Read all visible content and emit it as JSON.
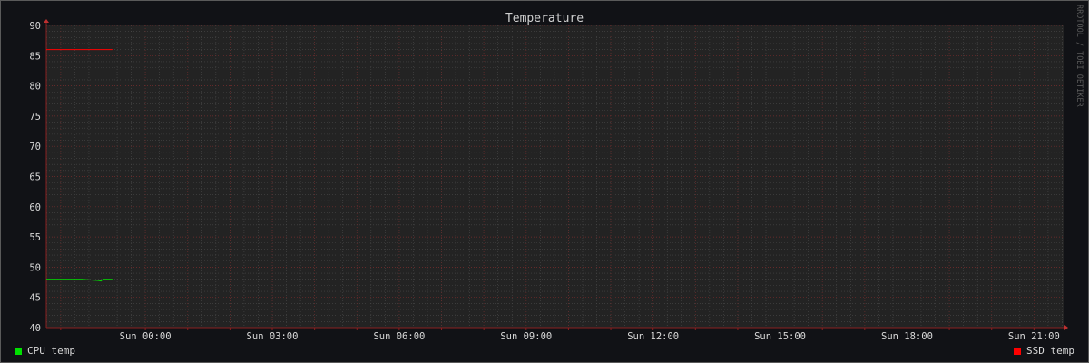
{
  "chart_data": {
    "type": "line",
    "title": "Temperature",
    "watermark": "RRDTOOL / TOBI OETIKER",
    "y_range": [
      40,
      90
    ],
    "y_ticks": [
      40,
      45,
      50,
      55,
      60,
      65,
      70,
      75,
      80,
      85,
      90
    ],
    "x_tick_labels": [
      "Sun 00:00",
      "Sun 03:00",
      "Sun 06:00",
      "Sun 09:00",
      "Sun 12:00",
      "Sun 15:00",
      "Sun 18:00",
      "Sun 21:00"
    ],
    "x_tick_hours": [
      0,
      3,
      6,
      9,
      12,
      15,
      18,
      21
    ],
    "x_range_hours": [
      -2.34,
      21.7
    ],
    "grid": true,
    "legend_placement": "bottom",
    "background_color": "#232323",
    "series": [
      {
        "name": "CPU temp",
        "color": "#00e000",
        "points": [
          [
            -2.34,
            48
          ],
          [
            -1.5,
            48
          ],
          [
            -1.1,
            47.8
          ],
          [
            -1.05,
            47.7
          ],
          [
            -1.0,
            48
          ],
          [
            -0.78,
            48
          ]
        ]
      },
      {
        "name": "SSD temp",
        "color": "#ff0000",
        "points": [
          [
            -2.34,
            86
          ],
          [
            -0.78,
            86
          ]
        ]
      }
    ]
  }
}
